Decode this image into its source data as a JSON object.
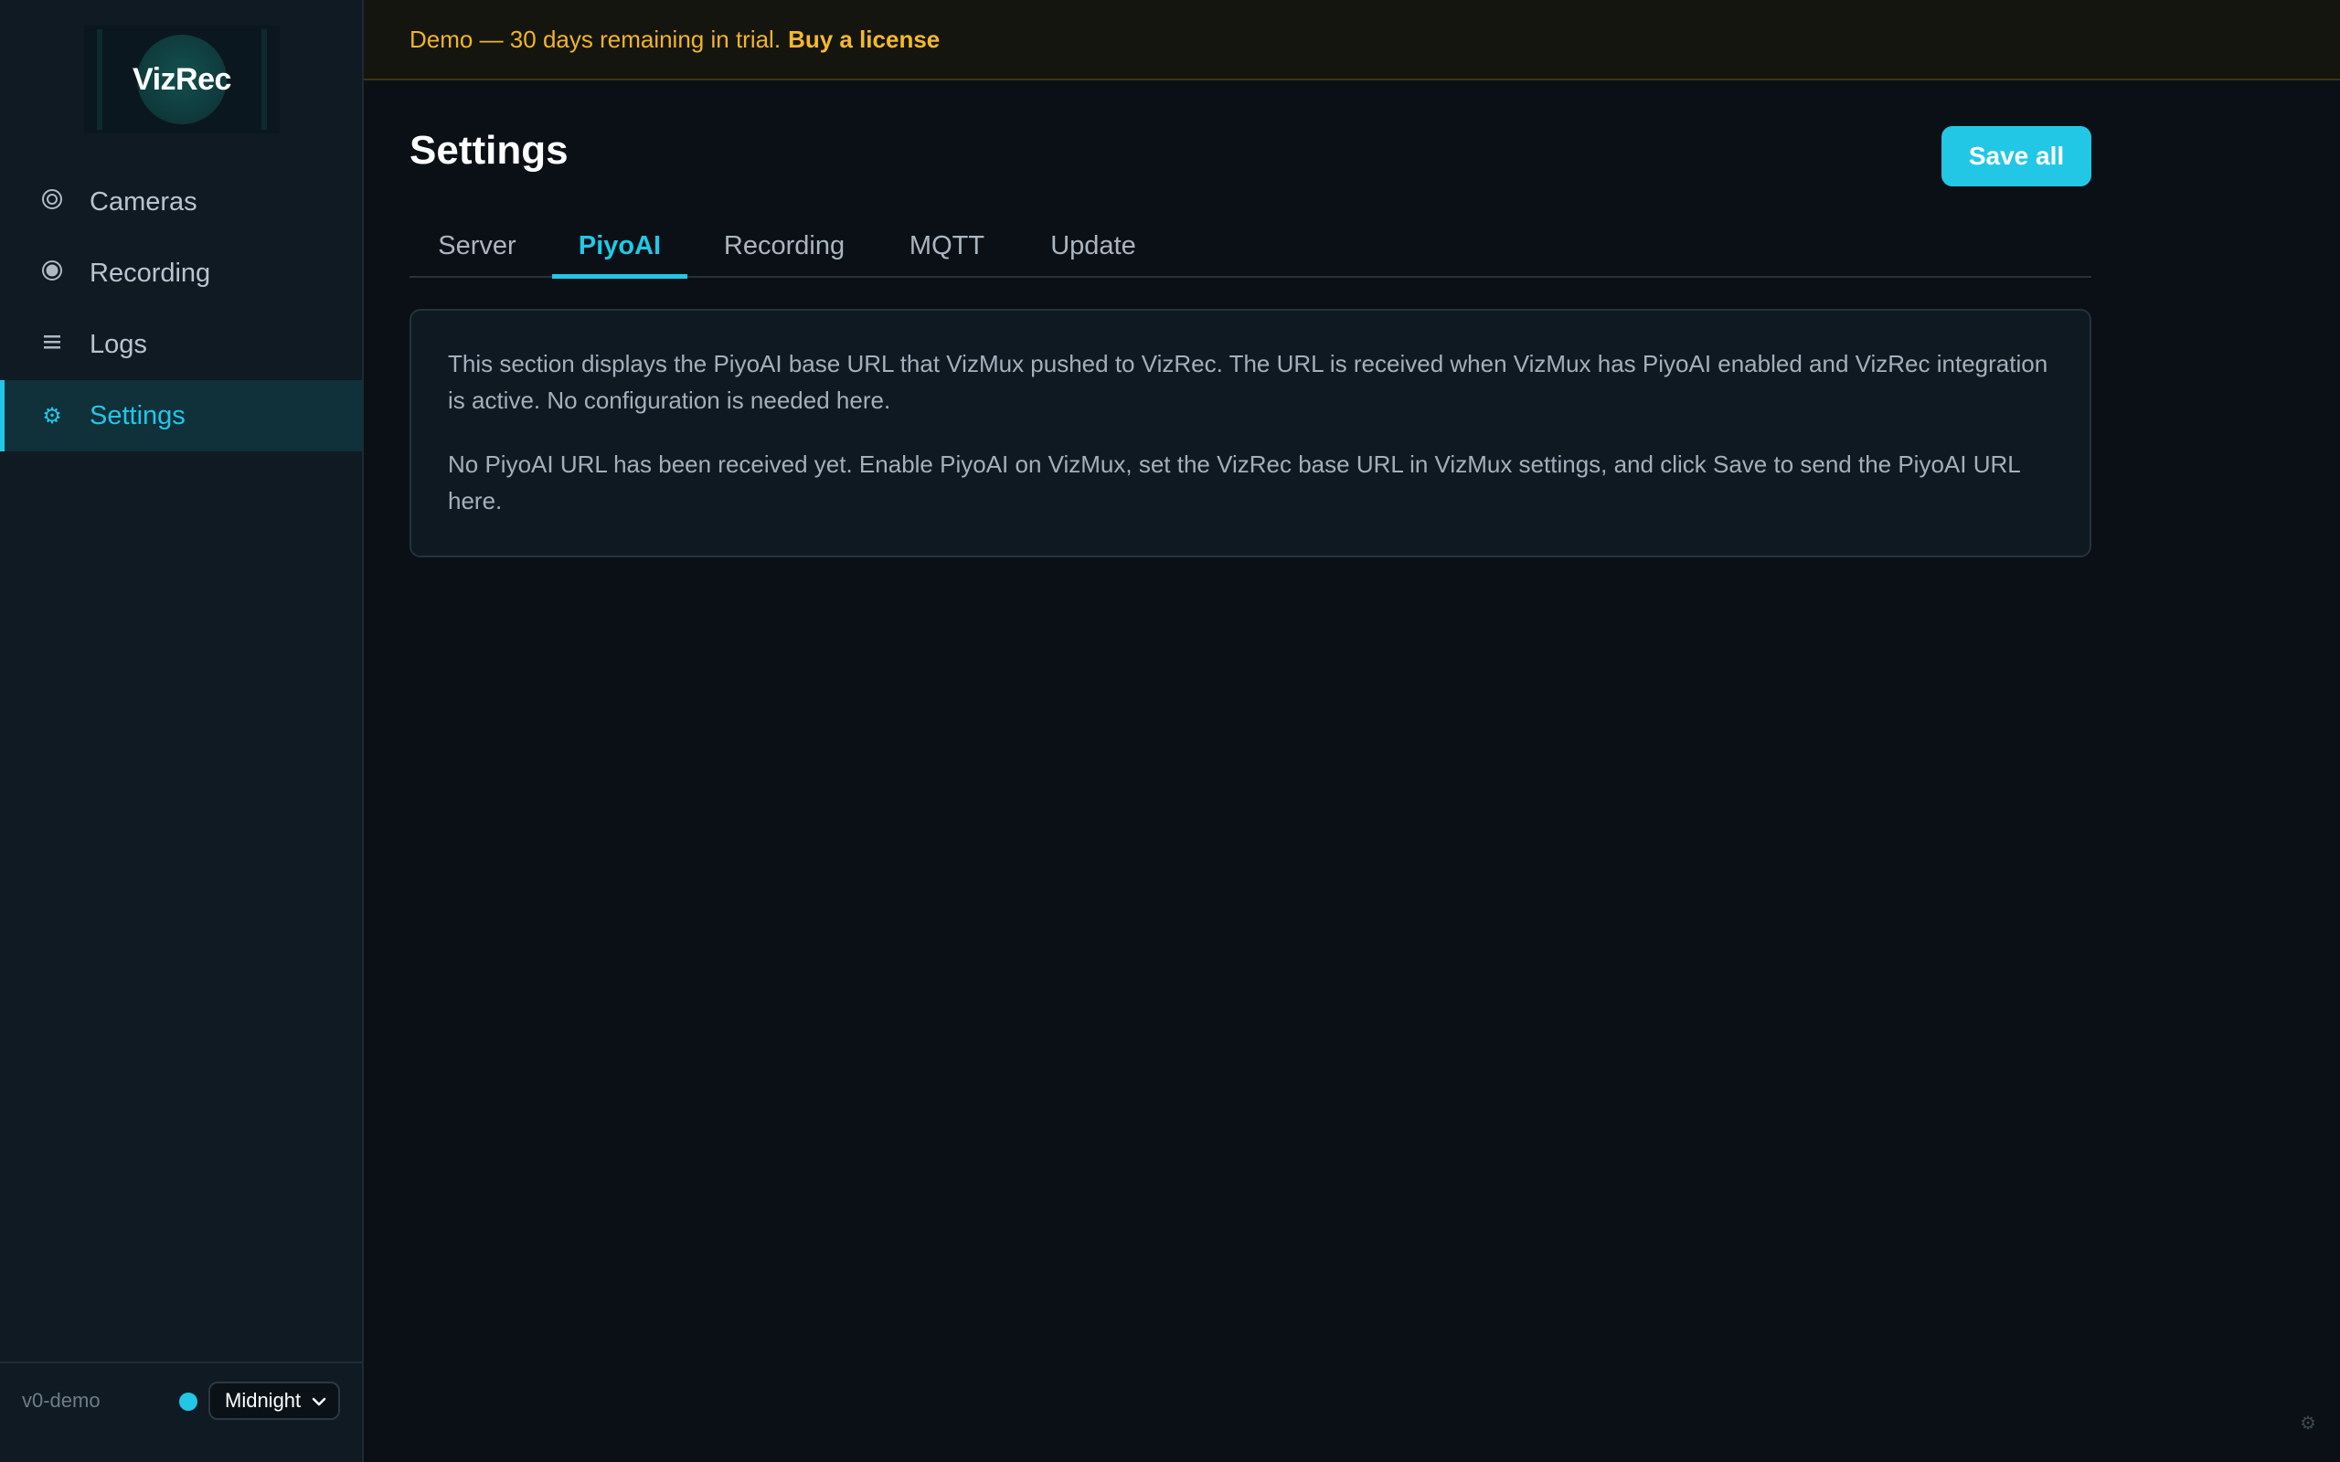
{
  "app": {
    "logo_text": "VizRec",
    "version": "v0-demo"
  },
  "sidebar": {
    "items": [
      {
        "label": "Cameras",
        "icon": "camera-ring-icon"
      },
      {
        "label": "Recording",
        "icon": "record-dot-icon"
      },
      {
        "label": "Logs",
        "icon": "list-icon"
      },
      {
        "label": "Settings",
        "icon": "gear-icon",
        "active": true
      }
    ]
  },
  "theme": {
    "selected": "Midnight",
    "accent_color": "#22c7e6"
  },
  "banner": {
    "text": "Demo — 30 days remaining in trial.",
    "link": "Buy a license",
    "color": "#f0b429"
  },
  "main": {
    "title": "Settings",
    "save_label": "Save all",
    "tabs": [
      {
        "label": "Server"
      },
      {
        "label": "PiyoAI",
        "active": true
      },
      {
        "label": "Recording"
      },
      {
        "label": "MQTT"
      },
      {
        "label": "Update"
      }
    ],
    "card": {
      "paragraph1": "This section displays the PiyoAI base URL that VizMux pushed to VizRec. The URL is received when VizMux has PiyoAI enabled and VizRec integration is active. No configuration is needed here.",
      "paragraph2": "No PiyoAI URL has been received yet. Enable PiyoAI on VizMux, set the VizRec base URL in VizMux settings, and click Save to send the PiyoAI URL here."
    }
  }
}
